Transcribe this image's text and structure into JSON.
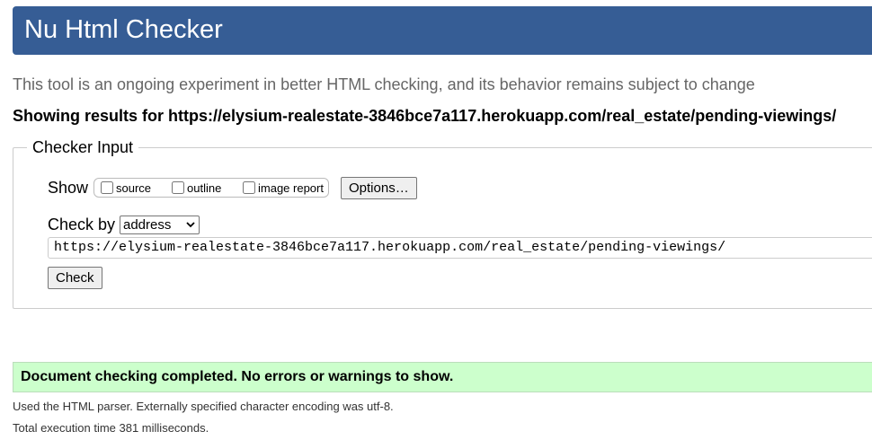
{
  "header": {
    "title": "Nu Html Checker"
  },
  "tagline": "This tool is an ongoing experiment in better HTML checking, and its behavior remains subject to change",
  "results_heading": "Showing results for https://elysium-realestate-3846bce7a117.herokuapp.com/real_estate/pending-viewings/",
  "checker_input": {
    "legend": "Checker Input",
    "show_label": "Show",
    "options": {
      "source": "source",
      "outline": "outline",
      "image_report": "image report"
    },
    "options_button": "Options…",
    "check_by_label": "Check by",
    "check_by_value": "address",
    "url_value": "https://elysium-realestate-3846bce7a117.herokuapp.com/real_estate/pending-viewings/",
    "check_button": "Check"
  },
  "result": {
    "message": "Document checking completed. No errors or warnings to show."
  },
  "footer": {
    "parser_note": "Used the HTML parser. Externally specified character encoding was utf-8.",
    "execution_time": "Total execution time 381 milliseconds."
  },
  "colors": {
    "header_bg": "#365d95",
    "success_bg": "#ccffcc"
  }
}
